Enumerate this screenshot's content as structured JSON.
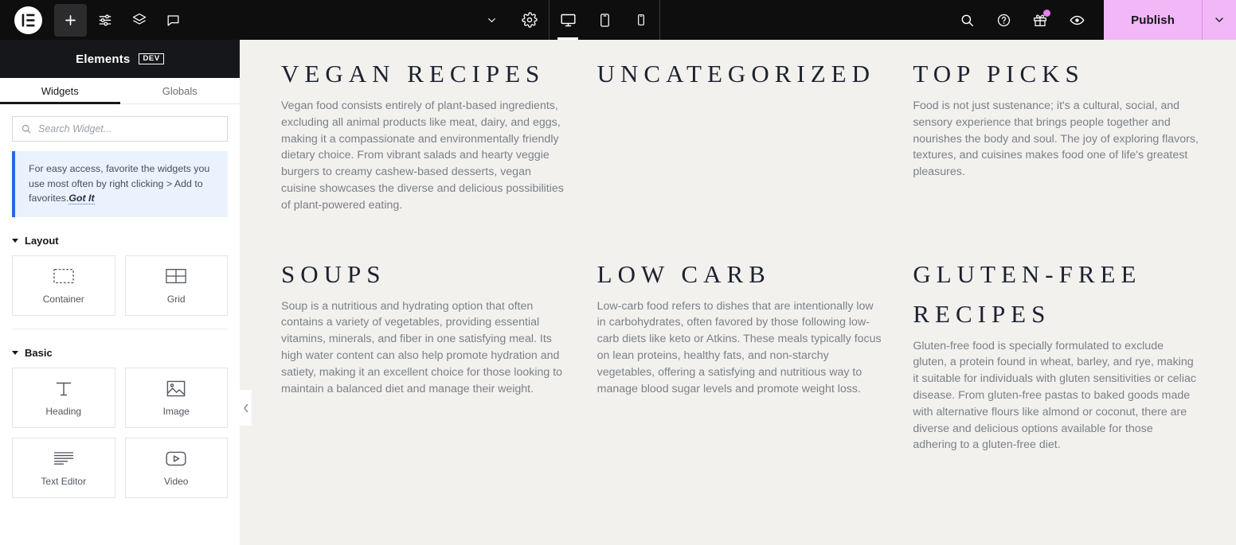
{
  "topbar": {
    "logo": {
      "name": "elementor-logo",
      "label": "Elementor"
    },
    "left_icons": [
      {
        "name": "add-element-button",
        "icon": "plus-icon",
        "label": "Add Element",
        "active": true
      },
      {
        "name": "site-settings-button",
        "icon": "sliders-icon",
        "label": "Site Settings"
      },
      {
        "name": "structure-button",
        "icon": "layers-icon",
        "label": "Structure"
      },
      {
        "name": "notes-button",
        "icon": "comment-icon",
        "label": "Notes"
      }
    ],
    "center": {
      "page_settings_chevron": {
        "name": "page-settings-chevron",
        "icon": "chevron-down-icon"
      },
      "settings": {
        "name": "settings-button",
        "icon": "gear-icon",
        "label": "Settings"
      },
      "devices": [
        {
          "name": "device-desktop",
          "icon": "desktop-icon",
          "label": "Desktop",
          "active": true
        },
        {
          "name": "device-tablet",
          "icon": "tablet-icon",
          "label": "Tablet",
          "active": false
        },
        {
          "name": "device-mobile",
          "icon": "mobile-icon",
          "label": "Mobile",
          "active": false
        }
      ]
    },
    "right_icons": [
      {
        "name": "search-button",
        "icon": "search-icon",
        "label": "Search"
      },
      {
        "name": "help-button",
        "icon": "help-icon",
        "label": "Help"
      },
      {
        "name": "whats-new-button",
        "icon": "gift-icon",
        "label": "What's New",
        "badge": true
      },
      {
        "name": "preview-button",
        "icon": "eye-icon",
        "label": "Preview Changes"
      }
    ],
    "publish": {
      "label": "Publish",
      "bg": "#f1b7f7",
      "text_color": "#16171a"
    },
    "publish_options_icon": "chevron-down-icon"
  },
  "panel": {
    "title": "Elements",
    "badge": "DEV",
    "tabs": [
      {
        "label": "Widgets",
        "active": true
      },
      {
        "label": "Globals",
        "active": false
      }
    ],
    "search": {
      "placeholder": "Search Widget...",
      "value": ""
    },
    "notice": {
      "text": "For easy access, favorite the widgets you use most often by right clicking > Add to favorites.",
      "action": "Got It",
      "accent": "#2b66e8",
      "bg": "#eaf2fd"
    },
    "sections": [
      {
        "label": "Layout",
        "widgets": [
          {
            "label": "Container",
            "icon": "container-icon"
          },
          {
            "label": "Grid",
            "icon": "grid-icon"
          }
        ]
      },
      {
        "label": "Basic",
        "widgets": [
          {
            "label": "Heading",
            "icon": "heading-icon"
          },
          {
            "label": "Image",
            "icon": "image-icon"
          },
          {
            "label": "Text Editor",
            "icon": "text-editor-icon"
          },
          {
            "label": "Video",
            "icon": "video-icon"
          }
        ]
      }
    ],
    "collapse_handle_icon": "chevron-left-icon"
  },
  "canvas": {
    "background": "#f2f1ee",
    "categories": [
      {
        "title": "Vegan Recipes",
        "body": "Vegan food consists entirely of plant-based ingredients, excluding all animal products like meat, dairy, and eggs, making it a compassionate and environmentally friendly dietary choice. From vibrant salads and hearty veggie burgers to creamy cashew-based desserts, vegan cuisine showcases the diverse and delicious possibilities of plant-powered eating."
      },
      {
        "title": "Uncategorized",
        "body": ""
      },
      {
        "title": "Top Picks",
        "body": "Food is not just sustenance; it's a cultural, social, and sensory experience that brings people together and nourishes the body and soul. The joy of exploring flavors, textures, and cuisines makes food one of life's greatest pleasures."
      },
      {
        "title": "Soups",
        "body": "Soup is a nutritious and hydrating option that often contains a variety of vegetables, providing essential vitamins, minerals, and fiber in one satisfying meal. Its high water content can also help promote hydration and satiety, making it an excellent choice for those looking to maintain a balanced diet and manage their weight."
      },
      {
        "title": "Low Carb",
        "body": "Low-carb food refers to dishes that are intentionally low in carbohydrates, often favored by those following low-carb diets like keto or Atkins. These meals typically focus on lean proteins, healthy fats, and non-starchy vegetables, offering a satisfying and nutritious way to manage blood sugar levels and promote weight loss."
      },
      {
        "title": "Gluten-Free Recipes",
        "body": "Gluten-free food is specially formulated to exclude gluten, a protein found in wheat, barley, and rye, making it suitable for individuals with gluten sensitivities or celiac disease. From gluten-free pastas to baked goods made with alternative flours like almond or coconut, there are diverse and delicious options available for those adhering to a gluten-free diet."
      }
    ]
  }
}
